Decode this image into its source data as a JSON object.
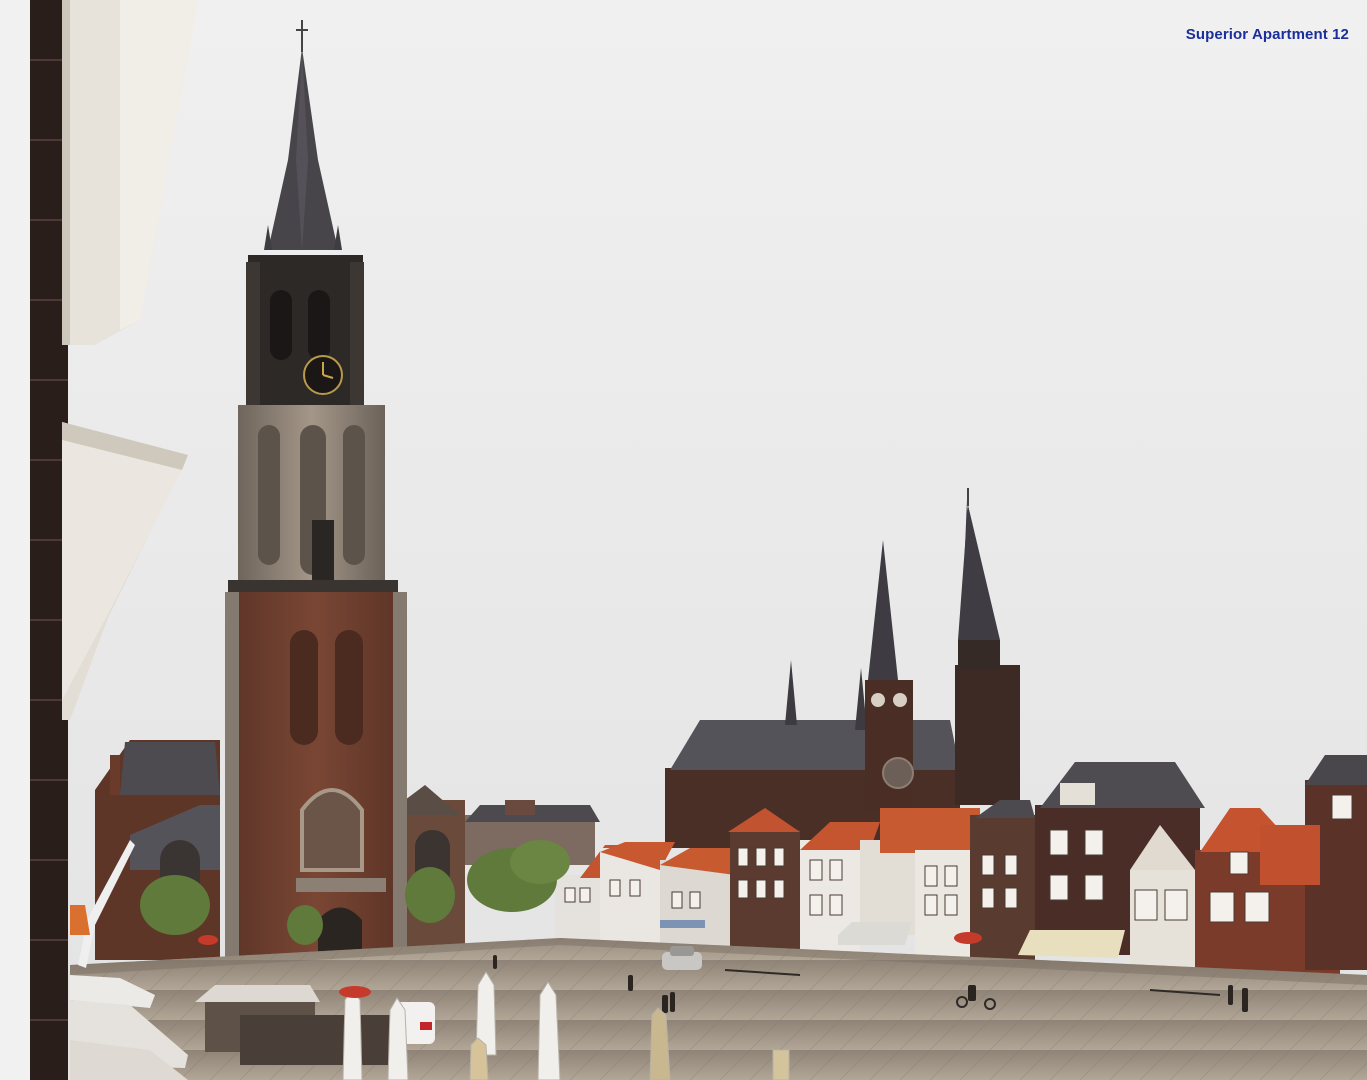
{
  "photo": {
    "caption": "Superior Apartment 12",
    "caption_color": "#1b2f9c",
    "description_icon": "photo-image"
  },
  "palette": {
    "sky": "#ececec",
    "tower_stone": "#8d7f72",
    "tower_dark": "#2b2724",
    "brick": "#6b3b2c",
    "roof_orange": "#c8532f",
    "roof_slate": "#4e4c50",
    "square": "#9c8f80"
  }
}
